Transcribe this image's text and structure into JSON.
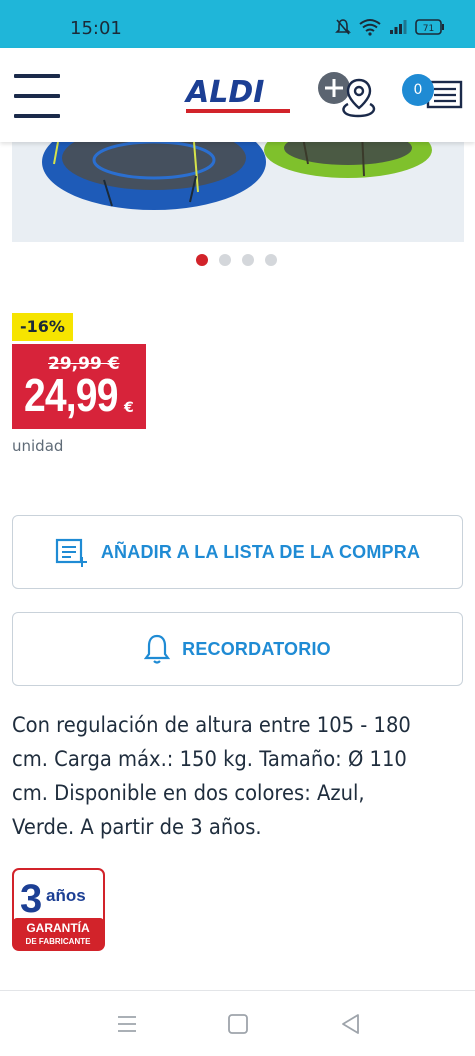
{
  "status_bar": {
    "time": "15:01",
    "battery": "71"
  },
  "header": {
    "logo_text": "ALDI",
    "cart_count": "0"
  },
  "carousel": {
    "total_dots": 4,
    "active_index": 0,
    "product_colors": [
      "#1e5bb8",
      "#7fc12c"
    ]
  },
  "price": {
    "discount": "-16%",
    "old_price": "29,99 €",
    "current_price": "24,99",
    "currency": "€",
    "unit": "unidad"
  },
  "actions": {
    "add_to_list_label": "AÑADIR A LA LISTA DE LA COMPRA",
    "reminder_label": "RECORDATORIO"
  },
  "description": "Con regulación de altura entre 105 - 180 cm. Carga máx.: 150 kg. Tamaño: Ø 110 cm. Disponible en dos colores: Azul, Verde. A partir de 3 años.",
  "warranty_badge": {
    "number": "3",
    "years": "años",
    "line1": "GARANTÍA",
    "line2": "DE FABRICANTE"
  },
  "colors": {
    "status_bar": "#1fb6d9",
    "aldi_blue": "#1c3f94",
    "aldi_red": "#d2232a",
    "accent_blue": "#1f8bd4",
    "price_red": "#d7233a",
    "badge_yellow": "#f6e400"
  },
  "icons": {
    "menu": "hamburger-icon",
    "store": "add-store-location-icon",
    "cart": "shopping-list-icon",
    "list_add": "list-add-icon",
    "bell": "bell-icon"
  }
}
